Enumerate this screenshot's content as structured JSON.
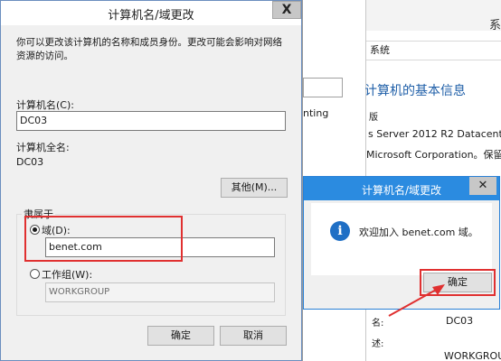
{
  "background_system": {
    "title": "系",
    "breadcrumb": "系统",
    "heading": "计算机的基本信息",
    "section1": "版",
    "os_text": "s Server 2012 R2 Datacenter",
    "corp_text": "Microsoft Corporation。保留所",
    "bottom_label1": "名:",
    "computer_value": "DC03",
    "bottom_label2": "述:",
    "workgroup_value": "WORKGROUP"
  },
  "background_middle": {
    "text": "nting"
  },
  "dialog": {
    "title": "计算机名/域更改",
    "close": "X",
    "description": "你可以更改该计算机的名称和成员身份。更改可能会影响对网络资源的访问。",
    "computer_name_label": "计算机名(C):",
    "computer_name_value": "DC03",
    "full_name_label": "计算机全名:",
    "full_name_value": "DC03",
    "more_button": "其他(M)...",
    "member_of_label": "隶属于",
    "domain_label": "域(D):",
    "domain_value": "benet.com",
    "workgroup_label": "工作组(W):",
    "workgroup_value": "WORKGROUP",
    "ok_button": "确定",
    "cancel_button": "取消"
  },
  "popup": {
    "title": "计算机名/域更改",
    "close": "✕",
    "message": "欢迎加入 benet.com 域。",
    "icon_glyph": "i",
    "ok_button": "确定"
  },
  "colors": {
    "popup_title_bar": "#2b8be0",
    "annotation_red": "#e03030",
    "info_icon": "#1f6fc5"
  }
}
